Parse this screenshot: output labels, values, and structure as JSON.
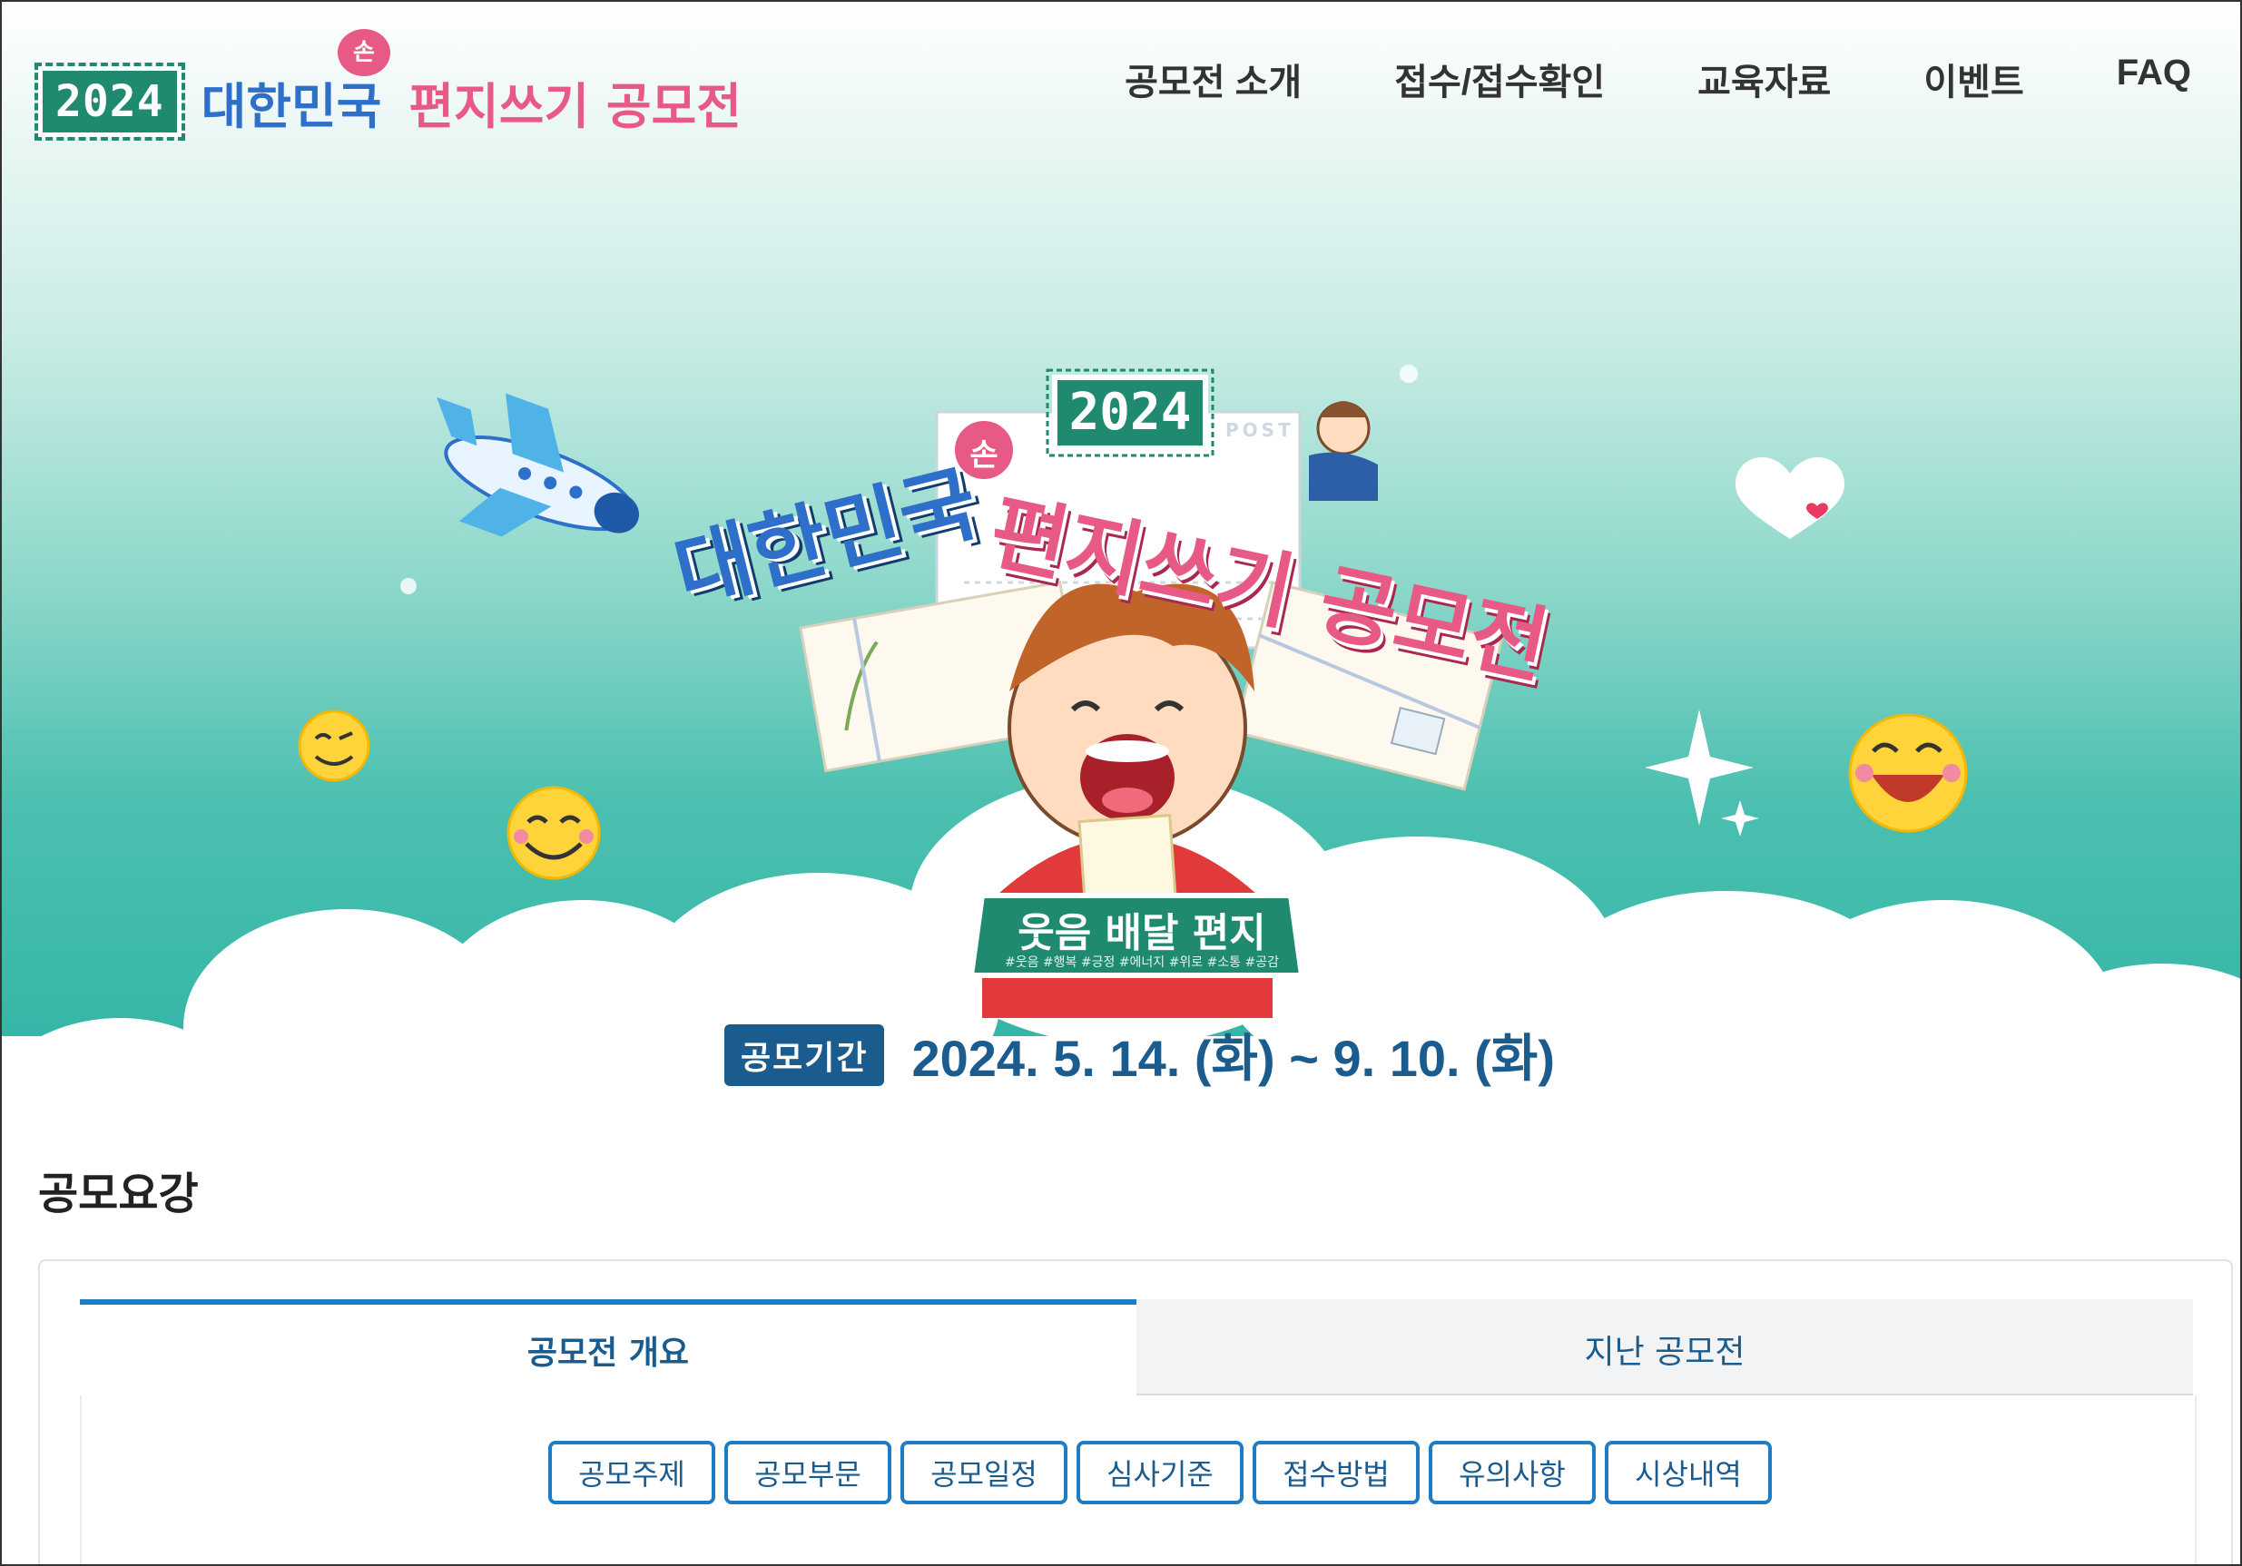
{
  "header": {
    "logo": {
      "year": "2024",
      "title_blue": "대한민국",
      "hand_badge": "손",
      "title_pink": "편지쓰기 공모전"
    },
    "nav": [
      "공모전 소개",
      "접수/접수확인",
      "교육자료",
      "이벤트",
      "FAQ"
    ]
  },
  "hero": {
    "year": "2024",
    "title_blue": "대한민국",
    "hand_badge": "손",
    "title_pink": "편지쓰기 공모전",
    "post_stamp": "POST",
    "theme": "웃음 배달 편지",
    "hashtags": "#웃음 #행복 #긍정 #에너지 #위로 #소통 #공감",
    "period_label": "공모기간",
    "period": "2024. 5. 14. (화) ~ 9. 10. (화)"
  },
  "main": {
    "section_title": "공모요강",
    "tabs": [
      {
        "label": "공모전 개요",
        "active": true
      },
      {
        "label": "지난 공모전",
        "active": false
      }
    ],
    "subnav": [
      "공모주제",
      "공모부문",
      "공모일정",
      "심사기준",
      "접수방법",
      "유의사항",
      "시상내역"
    ]
  },
  "colors": {
    "brand_green": "#1f8a6f",
    "brand_blue": "#2d6fc9",
    "brand_pink": "#e85a86",
    "accent_blue": "#1e7cc4",
    "teal_bg": "#2fb3a3"
  }
}
